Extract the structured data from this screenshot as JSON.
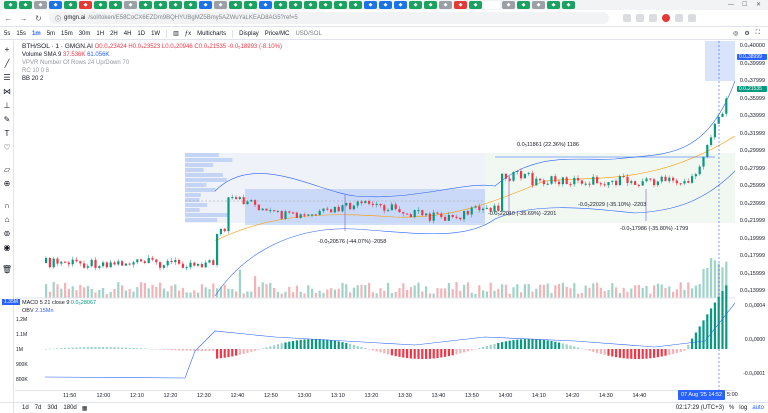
{
  "browser": {
    "tabs": [
      "green",
      "green",
      "grey",
      "blue",
      "green",
      "red",
      "green",
      "green",
      "grey",
      "green",
      "green",
      "green",
      "green",
      "blue",
      "grey",
      "green",
      "green",
      "blue",
      "green",
      "green",
      "green",
      "green",
      "green",
      "green",
      "blue",
      "blue",
      "blue",
      "green",
      "green",
      "grey",
      "red",
      "green",
      "active",
      "grey",
      "green",
      "grey",
      "green",
      "green"
    ],
    "url_host": "gmgn.ai",
    "url_path": "/sol/token/E58CoCX6EZDm9BQHYUBgMZ5Bmy5AZWuYaLKEAD8AG5?ref=5",
    "min_label": "—",
    "max_label": "☐",
    "close_label": "✕"
  },
  "toolbar": {
    "intervals": [
      "5s",
      "15s",
      "1m",
      "5m",
      "15m",
      "30m",
      "1H",
      "2H",
      "4H",
      "1D",
      "1W"
    ],
    "active_interval": "1m",
    "multicharts": "Multicharts",
    "display": "Display",
    "price_mc": "Price/MC",
    "usd_sol": "USD/SOL"
  },
  "legend": {
    "title": "BTH/SOL · 1 · GMGN.AI",
    "ohlc": "O0.0₄23424 H0.0₄23523 L0.0₄20946 C0.0₄21535 -0.0₅18993 (-8.10%)",
    "volume_label": "Volume SMA 9",
    "volume_value": "37.536K",
    "volume_value2": "61.056K",
    "vpvr": "VPVR Number Of Rows 24 Up/Down 70",
    "rc": "RC 10 0 8",
    "bb": "BB 20 2"
  },
  "price_axis": [
    "0.0₄40000",
    "0.0₄39999",
    "0.0₄37999",
    "0.0₄35999",
    "0.0₄33999",
    "0.0₄31999",
    "0.0₄29999",
    "0.0₄27999",
    "0.0₄25999",
    "0.0₄23999",
    "0.0₄21999",
    "0.0₄19999",
    "0.0₄17999",
    "0.0₄15999",
    "0.0₄13999"
  ],
  "price_tags": {
    "current": "0.0₄21535",
    "upper": "0.0₄38999"
  },
  "annotations": {
    "top": "0.0₅11861 (22.36%) 1186",
    "mid_left": "-0.0₅22010 (-35.69%) -2201",
    "mid_right": "-0.0₅22029 (-35.10%) -2203",
    "right": "-0.0₅17986 (-35.80%) -1799",
    "left": "-0.0₅20576 (-44.07%) -2058"
  },
  "osc": {
    "macd": "MACD 5 21 close 9",
    "macd_val": "0.0₆28067",
    "obv": "OBV",
    "obv_val": "2.15Mn",
    "left_tag": "1.35M"
  },
  "osc_axis": [
    "0.0₆0004",
    "0.0₆0000",
    "-0.0₆0001"
  ],
  "obv_axis": [
    "1.2M",
    "1.1M",
    "1M",
    "900K",
    "800K"
  ],
  "time_labels": [
    "11:50",
    "12:00",
    "12:10",
    "12:20",
    "12:30",
    "12:40",
    "12:50",
    "13:00",
    "13:10",
    "13:20",
    "13:30",
    "13:40",
    "13:50",
    "14:00",
    "14:10",
    "14:20",
    "14:30",
    "14:40"
  ],
  "cursor_time": "07 Aug '25  14:52",
  "cursor_time2": "5:00",
  "bottombar": {
    "ranges": [
      "1d",
      "7d",
      "30d",
      "180d"
    ],
    "clock": "02:17:29 (UTC+3)",
    "pct": "%",
    "log": "log",
    "auto": "auto"
  }
}
